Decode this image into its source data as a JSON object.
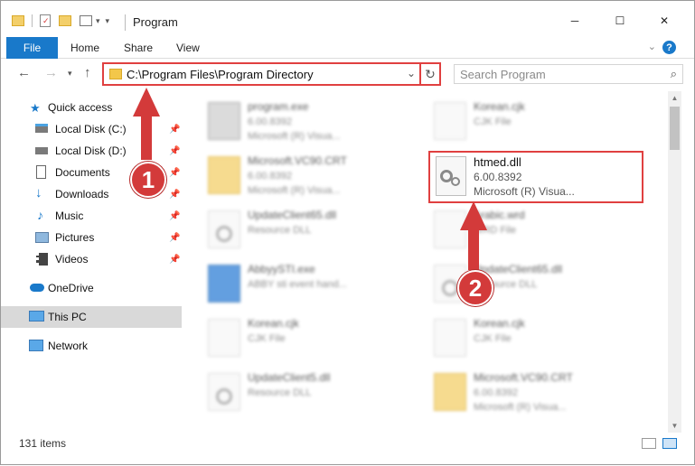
{
  "window": {
    "title": "Program",
    "minimize": "─",
    "maximize": "☐",
    "close": "✕"
  },
  "ribbon": {
    "file": "File",
    "home": "Home",
    "share": "Share",
    "view": "View",
    "help": "?"
  },
  "nav": {
    "address": "C:\\Program Files\\Program Directory",
    "search_placeholder": "Search Program"
  },
  "sidebar": {
    "items": [
      {
        "label": "Quick access",
        "icon": "star-icon"
      },
      {
        "label": "Local Disk (C:)",
        "icon": "drive-icon",
        "pinned": true
      },
      {
        "label": "Local Disk (D:)",
        "icon": "drive-icon",
        "pinned": true
      },
      {
        "label": "Documents",
        "icon": "documents-icon",
        "pinned": true
      },
      {
        "label": "Downloads",
        "icon": "download-icon",
        "pinned": true
      },
      {
        "label": "Music",
        "icon": "music-icon",
        "pinned": true
      },
      {
        "label": "Pictures",
        "icon": "pictures-icon",
        "pinned": true
      },
      {
        "label": "Videos",
        "icon": "videos-icon",
        "pinned": true
      },
      {
        "label": "OneDrive",
        "icon": "cloud-icon"
      },
      {
        "label": "This PC",
        "icon": "computer-icon",
        "selected": true
      },
      {
        "label": "Network",
        "icon": "network-icon"
      }
    ]
  },
  "files": [
    {
      "name": "program.exe",
      "sub1": "6.00.8392",
      "sub2": "Microsoft (R) Visua...",
      "type": "exe"
    },
    {
      "name": "Korean.cjk",
      "sub1": "CJK File",
      "sub2": "",
      "type": "blank"
    },
    {
      "name": "Microsoft.VC90.CRT",
      "sub1": "6.00.8392",
      "sub2": "Microsoft (R) Visua...",
      "type": "folder"
    },
    {
      "name": "htmed.dll",
      "sub1": "6.00.8392",
      "sub2": "Microsoft (R) Visua...",
      "type": "dll",
      "highlighted": true
    },
    {
      "name": "UpdateClient65.dll",
      "sub1": "Resource DLL",
      "sub2": "",
      "type": "dll"
    },
    {
      "name": "Arabic.wrd",
      "sub1": "WRD File",
      "sub2": "",
      "type": "blank"
    },
    {
      "name": "AbbyySTI.exe",
      "sub1": "ABBY sti event hand...",
      "sub2": "",
      "type": "app"
    },
    {
      "name": "UpdateClient65.dll",
      "sub1": "Resource DLL",
      "sub2": "",
      "type": "dll"
    },
    {
      "name": "Korean.cjk",
      "sub1": "CJK File",
      "sub2": "",
      "type": "blank"
    },
    {
      "name": "Korean.cjk",
      "sub1": "CJK File",
      "sub2": "",
      "type": "blank"
    },
    {
      "name": "UpdateClient5.dll",
      "sub1": "Resource DLL",
      "sub2": "",
      "type": "dll"
    },
    {
      "name": "Microsoft.VC90.CRT",
      "sub1": "6.00.8392",
      "sub2": "Microsoft (R) Visua...",
      "type": "folder"
    }
  ],
  "status": {
    "count": "131 items"
  },
  "callouts": {
    "one": "1",
    "two": "2"
  },
  "colors": {
    "accent": "#1979ca",
    "highlight": "#e04040"
  }
}
